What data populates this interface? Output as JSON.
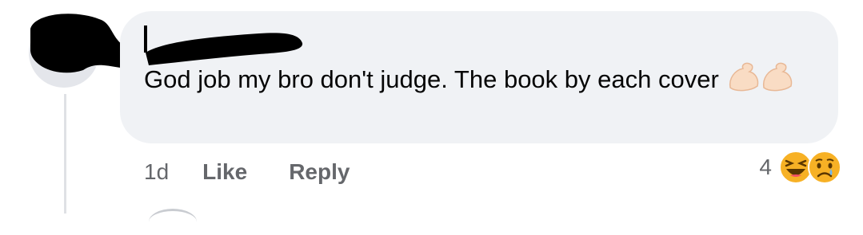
{
  "comment": {
    "text": "God job my bro don't judge. The book by each cover",
    "emoji": "flexed-biceps-icon x2"
  },
  "actions": {
    "timestamp": "1d",
    "like_label": "Like",
    "reply_label": "Reply"
  },
  "reactions": {
    "count": "4",
    "types": [
      "haha",
      "sad"
    ]
  },
  "colors": {
    "bubble": "#f0f2f5",
    "text": "#050505",
    "meta": "#65676b",
    "reaction_yellow": "#f7b125"
  }
}
